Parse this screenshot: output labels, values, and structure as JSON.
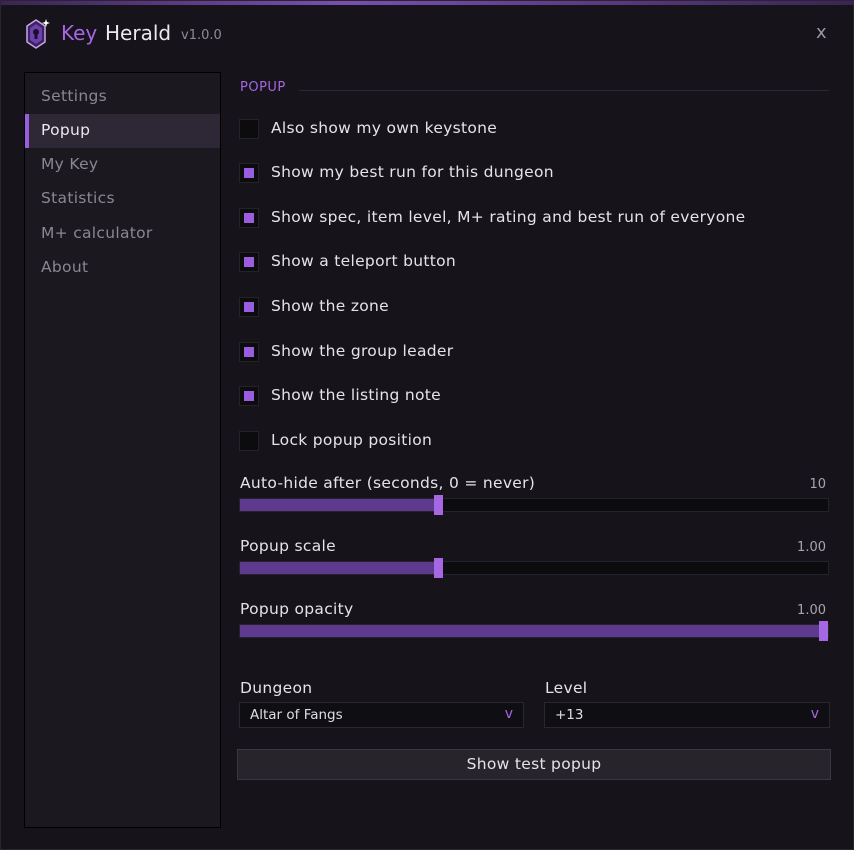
{
  "app": {
    "title_accent": "Key",
    "title_main": "Herald",
    "version": "v1.0.0",
    "close_label": "x",
    "accent_color": "#a567e3",
    "icon": "keystone-logo-icon"
  },
  "sidebar": {
    "items": [
      {
        "label": "Settings",
        "active": false
      },
      {
        "label": "Popup",
        "active": true
      },
      {
        "label": "My Key",
        "active": false
      },
      {
        "label": "Statistics",
        "active": false
      },
      {
        "label": "M+ calculator",
        "active": false
      },
      {
        "label": "About",
        "active": false
      }
    ]
  },
  "popup": {
    "section_title": "POPUP",
    "options": [
      {
        "label": "Also show my own keystone",
        "checked": false
      },
      {
        "label": "Show my best run for this dungeon",
        "checked": true
      },
      {
        "label": "Show spec, item level, M+ rating and best run of everyone",
        "checked": true
      },
      {
        "label": "Show a teleport button",
        "checked": true
      },
      {
        "label": "Show the zone",
        "checked": true
      },
      {
        "label": "Show the group leader",
        "checked": true
      },
      {
        "label": "Show the listing note",
        "checked": true
      },
      {
        "label": "Lock popup position",
        "checked": false
      }
    ],
    "sliders": [
      {
        "label": "Auto-hide after (seconds, 0 = never)",
        "value": "10",
        "fraction": 0.335
      },
      {
        "label": "Popup scale",
        "value": "1.00",
        "fraction": 0.335
      },
      {
        "label": "Popup opacity",
        "value": "1.00",
        "fraction": 1.0
      }
    ],
    "dungeon": {
      "label": "Dungeon",
      "value": "Altar of Fangs",
      "chevron": "v"
    },
    "level": {
      "label": "Level",
      "value": "+13",
      "chevron": "v"
    },
    "test_button": "Show test popup"
  }
}
